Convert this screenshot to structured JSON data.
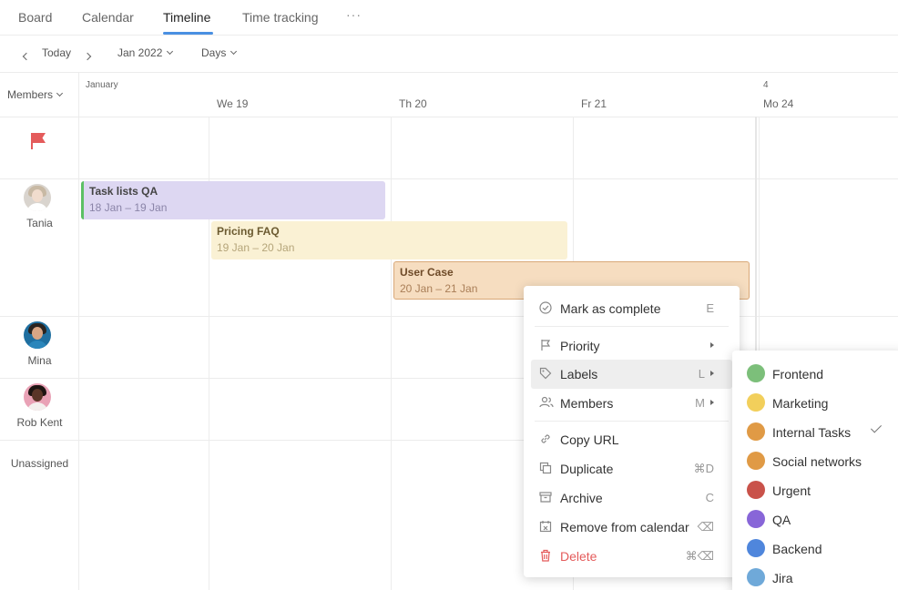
{
  "tabs": [
    "Board",
    "Calendar",
    "Timeline",
    "Time tracking"
  ],
  "tabs_more": "···",
  "toolbar": {
    "today": "Today",
    "month": "Jan 2022",
    "scale": "Days"
  },
  "sidebar": {
    "members_label": "Members",
    "members": [
      {
        "name": "Tania"
      },
      {
        "name": "Mina"
      },
      {
        "name": "Rob Kent"
      }
    ],
    "unassigned": "Unassigned"
  },
  "timeline": {
    "month": "January",
    "week": "4",
    "days": [
      "We 19",
      "Th 20",
      "Fr 21",
      "Mo 24"
    ]
  },
  "tasks": [
    {
      "title": "Task lists QA",
      "dates": "18 Jan – 19 Jan",
      "color": "#ddd7f2",
      "accent": "#5cc065"
    },
    {
      "title": "Pricing FAQ",
      "dates": "19 Jan – 20 Jan",
      "color": "#faf1d4"
    },
    {
      "title": "User Case",
      "dates": "20 Jan – 21 Jan",
      "color": "#f6ddc0"
    }
  ],
  "context_menu": {
    "items": [
      {
        "label": "Mark as complete",
        "key": "E",
        "icon": "check-circle-icon"
      },
      {
        "label": "Priority",
        "key": "",
        "icon": "flag-icon",
        "submenu": true
      },
      {
        "label": "Labels",
        "key": "L",
        "icon": "tag-icon",
        "submenu": true,
        "highlighted": true
      },
      {
        "label": "Members",
        "key": "M",
        "icon": "members-icon",
        "submenu": true
      },
      {
        "label": "Copy URL",
        "key": "",
        "icon": "link-icon"
      },
      {
        "label": "Duplicate",
        "key": "⌘D",
        "icon": "duplicate-icon"
      },
      {
        "label": "Archive",
        "key": "C",
        "icon": "archive-icon"
      },
      {
        "label": "Remove from calendar",
        "key": "⌫",
        "icon": "calendar-remove-icon"
      },
      {
        "label": "Delete",
        "key": "⌘⌫",
        "icon": "trash-icon",
        "danger": true
      }
    ]
  },
  "labels_menu": [
    {
      "name": "Frontend",
      "color": "#7cbf7a"
    },
    {
      "name": "Marketing",
      "color": "#f2cf5b"
    },
    {
      "name": "Internal Tasks",
      "color": "#e09a45",
      "checked": true
    },
    {
      "name": "Social networks",
      "color": "#e09a45"
    },
    {
      "name": "Urgent",
      "color": "#c9524a"
    },
    {
      "name": "QA",
      "color": "#8866d8"
    },
    {
      "name": "Backend",
      "color": "#4f86dc"
    },
    {
      "name": "Jira",
      "color": "#6fa9d9"
    }
  ],
  "colors": {
    "accent": "#4a90e2",
    "danger": "#e45b5b"
  }
}
